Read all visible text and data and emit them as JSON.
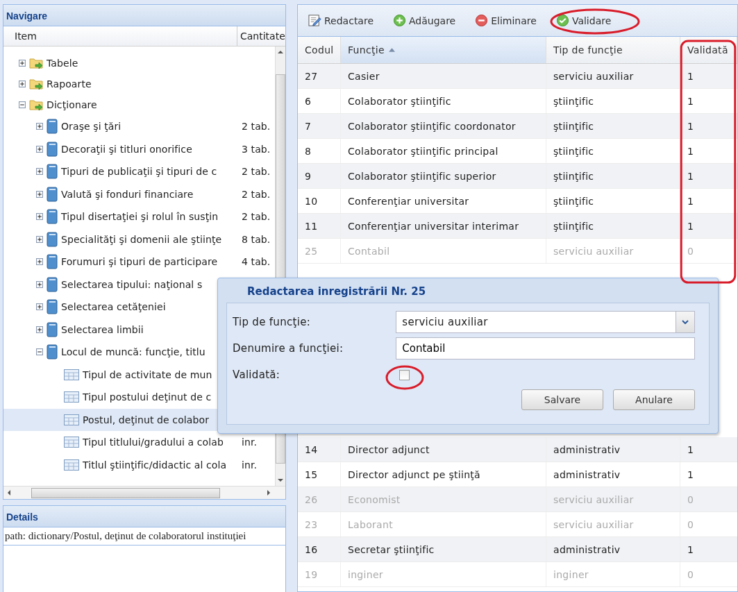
{
  "navigation": {
    "title": "Navigare",
    "columns": [
      "Item",
      "Cantitate"
    ],
    "tree": [
      {
        "label": "Tabele",
        "kind": "folder",
        "expanded": false,
        "selected": false
      },
      {
        "label": "Rapoarte",
        "kind": "folder",
        "expanded": false,
        "selected": false
      },
      {
        "label": "Dicţionare",
        "kind": "folder",
        "expanded": true,
        "selected": false,
        "children": [
          {
            "label": "Oraşe şi ţări",
            "quantity": "2 tab.",
            "kind": "book",
            "expanded": false,
            "selected": false
          },
          {
            "label": "Decoraţii şi titluri onorifice",
            "quantity": "3 tab.",
            "kind": "book",
            "expanded": false,
            "selected": false
          },
          {
            "label": "Tipuri de publicaţii şi tipuri de c",
            "quantity": "2 tab.",
            "kind": "book",
            "expanded": false,
            "selected": false
          },
          {
            "label": "Valută şi fonduri financiare",
            "quantity": "2 tab.",
            "kind": "book",
            "expanded": false,
            "selected": false
          },
          {
            "label": "Tipul disertaţiei şi rolul în susţin",
            "quantity": "2 tab.",
            "kind": "book",
            "expanded": false,
            "selected": false
          },
          {
            "label": "Specialităţi şi domenii ale ştiinţe",
            "quantity": "8 tab.",
            "kind": "book",
            "expanded": false,
            "selected": false
          },
          {
            "label": "Forumuri şi tipuri de participare",
            "quantity": "4 tab.",
            "kind": "book",
            "expanded": false,
            "selected": false
          },
          {
            "label": "Selectarea tipului: naţional s",
            "kind": "book",
            "expanded": false,
            "selected": false
          },
          {
            "label": "Selectarea cetăţeniei",
            "kind": "book",
            "expanded": false,
            "selected": false
          },
          {
            "label": "Selectarea limbii",
            "kind": "book",
            "expanded": false,
            "selected": false
          },
          {
            "label": "Locul de muncă: funcţie, titlu",
            "kind": "book",
            "expanded": true,
            "selected": false,
            "children": [
              {
                "label": "Tipul de activitate de mun",
                "kind": "table",
                "selected": false
              },
              {
                "label": "Tipul postului deţinut de c",
                "kind": "table",
                "selected": false
              },
              {
                "label": "Postul, deţinut de colabor",
                "kind": "table",
                "selected": true
              },
              {
                "label": "Tipul titlului/gradului a colab",
                "quantity": "inr.",
                "kind": "table",
                "selected": false
              },
              {
                "label": "Titlul ştiinţific/didactic al cola",
                "quantity": "inr.",
                "kind": "table",
                "selected": false
              }
            ]
          }
        ]
      }
    ]
  },
  "details": {
    "title": "Details",
    "path": "path: dictionary/Postul, deţinut de colaboratorul instituţiei"
  },
  "toolbar": [
    {
      "label": "Redactare",
      "kind": "edit"
    },
    {
      "label": "Adăugare",
      "kind": "add"
    },
    {
      "label": "Eliminare",
      "kind": "remove"
    },
    {
      "label": "Validare",
      "kind": "validate"
    }
  ],
  "grid": {
    "columns": [
      {
        "label": "Codul",
        "sorted": false
      },
      {
        "label": "Funcţie",
        "sorted": true
      },
      {
        "label": "Tip de funcţie",
        "sorted": false
      },
      {
        "label": "Validată",
        "sorted": false
      }
    ],
    "rows_above": [
      {
        "code": "27",
        "function": "Casier",
        "type": "serviciu auxiliar",
        "validated": "1",
        "disabled": false
      },
      {
        "code": "6",
        "function": "Colaborator ştiinţific",
        "type": "ştiinţific",
        "validated": "1",
        "disabled": false
      },
      {
        "code": "7",
        "function": "Colaborator ştiinţific coordonator",
        "type": "ştiinţific",
        "validated": "1",
        "disabled": false
      },
      {
        "code": "8",
        "function": "Colaborator ştiinţific principal",
        "type": "ştiinţific",
        "validated": "1",
        "disabled": false
      },
      {
        "code": "9",
        "function": "Colaborator ştiinţific superior",
        "type": "ştiinţific",
        "validated": "1",
        "disabled": false
      },
      {
        "code": "10",
        "function": "Conferenţiar universitar",
        "type": "ştiinţific",
        "validated": "1",
        "disabled": false
      },
      {
        "code": "11",
        "function": "Conferenţiar universitar interimar",
        "type": "ştiinţific",
        "validated": "1",
        "disabled": false
      },
      {
        "code": "25",
        "function": "Contabil",
        "type": "serviciu auxiliar",
        "validated": "0",
        "disabled": true
      }
    ],
    "rows_below": [
      {
        "code": "14",
        "function": "Director adjunct",
        "type": "administrativ",
        "validated": "1",
        "disabled": false
      },
      {
        "code": "15",
        "function": "Director adjunct pe ştiinţă",
        "type": "administrativ",
        "validated": "1",
        "disabled": false
      },
      {
        "code": "26",
        "function": "Economist",
        "type": "serviciu auxiliar",
        "validated": "0",
        "disabled": true
      },
      {
        "code": "23",
        "function": "Laborant",
        "type": "serviciu auxiliar",
        "validated": "0",
        "disabled": true
      },
      {
        "code": "16",
        "function": "Secretar ştiinţific",
        "type": "administrativ",
        "validated": "1",
        "disabled": false
      },
      {
        "code": "19",
        "function": "inginer",
        "type": "inginer",
        "validated": "0",
        "disabled": true
      }
    ]
  },
  "dialog": {
    "title": "Redactarea inregistrării Nr. 25",
    "fields": [
      {
        "kind": "select",
        "label": "Tip de funcţie:",
        "value": "serviciu auxiliar"
      },
      {
        "kind": "text",
        "label": "Denumire a funcţiei:",
        "value": "Contabil"
      },
      {
        "kind": "checkbox",
        "label": "Validată:",
        "checked": false
      }
    ],
    "buttons": [
      "Salvare",
      "Anulare"
    ]
  }
}
